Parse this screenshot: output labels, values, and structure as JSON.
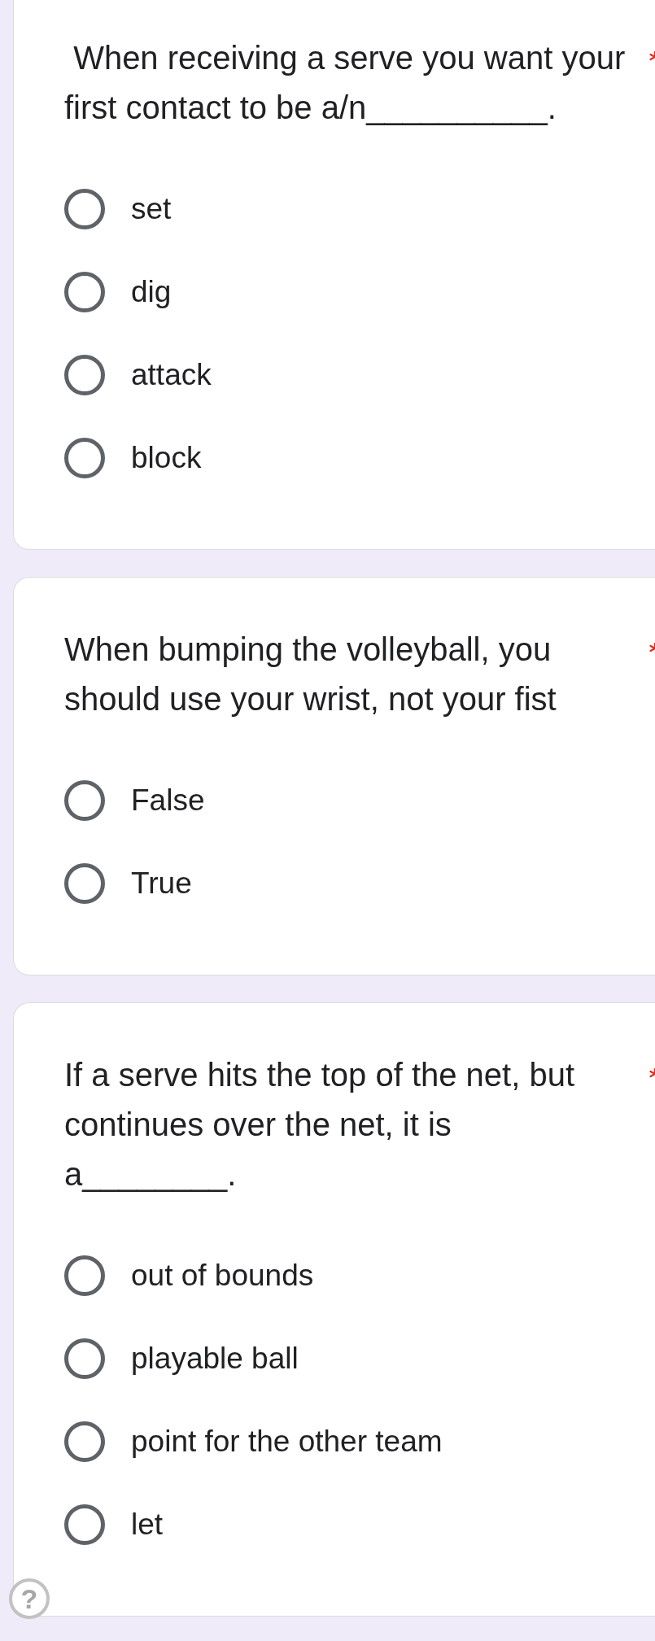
{
  "questions": [
    {
      "title": " When receiving a serve you want your first contact to be a/n__________.",
      "required": true,
      "options": [
        {
          "label": "set",
          "selected": false
        },
        {
          "label": "dig",
          "selected": false
        },
        {
          "label": "attack",
          "selected": false
        },
        {
          "label": "block",
          "selected": false
        }
      ]
    },
    {
      "title": "When bumping the volleyball, you should use your wrist, not your fist",
      "required": true,
      "options": [
        {
          "label": "False",
          "selected": false
        },
        {
          "label": "True",
          "selected": false
        }
      ]
    },
    {
      "title": "If a serve hits the top of the net, but continues over the net, it is a________.",
      "required": true,
      "options": [
        {
          "label": "out of bounds",
          "selected": false
        },
        {
          "label": "playable ball",
          "selected": false
        },
        {
          "label": "point for the other team",
          "selected": false
        },
        {
          "label": "let",
          "selected": false
        }
      ]
    }
  ],
  "help_button": {
    "label": "?"
  }
}
